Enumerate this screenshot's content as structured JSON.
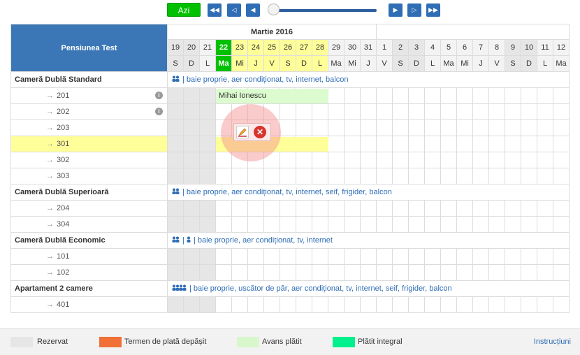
{
  "toolbar": {
    "today_label": "Azi"
  },
  "hotel": {
    "name": "Pensiunea Test"
  },
  "month": "Martie 2016",
  "days": [
    {
      "n": "19",
      "d": "S",
      "w": true
    },
    {
      "n": "20",
      "d": "D",
      "w": true
    },
    {
      "n": "21",
      "d": "L",
      "w": false
    },
    {
      "n": "22",
      "d": "Ma",
      "w": false,
      "today": true
    },
    {
      "n": "23",
      "d": "Mi",
      "y": true
    },
    {
      "n": "24",
      "d": "J",
      "y": true
    },
    {
      "n": "25",
      "d": "V",
      "y": true
    },
    {
      "n": "26",
      "d": "S",
      "y": true
    },
    {
      "n": "27",
      "d": "D",
      "y": true
    },
    {
      "n": "28",
      "d": "L",
      "y": true
    },
    {
      "n": "29",
      "d": "Ma"
    },
    {
      "n": "30",
      "d": "Mi"
    },
    {
      "n": "31",
      "d": "J"
    },
    {
      "n": "1",
      "d": "V"
    },
    {
      "n": "2",
      "d": "S",
      "w": true
    },
    {
      "n": "3",
      "d": "D",
      "w": true
    },
    {
      "n": "4",
      "d": "L"
    },
    {
      "n": "5",
      "d": "Ma"
    },
    {
      "n": "6",
      "d": "Mi"
    },
    {
      "n": "7",
      "d": "J"
    },
    {
      "n": "8",
      "d": "V"
    },
    {
      "n": "9",
      "d": "S",
      "w": true
    },
    {
      "n": "10",
      "d": "D",
      "w": true
    },
    {
      "n": "11",
      "d": "L"
    },
    {
      "n": "12",
      "d": "Ma"
    }
  ],
  "room_types": [
    {
      "name": "Cameră Dublă Standard",
      "desc": "| baie proprie, aer condiționat, tv, internet, balcon",
      "people_icons": 1,
      "rooms": [
        {
          "n": "201",
          "info": true
        },
        {
          "n": "202",
          "info": true
        },
        {
          "n": "203"
        },
        {
          "n": "301",
          "selected": true
        },
        {
          "n": "302"
        },
        {
          "n": "303"
        }
      ]
    },
    {
      "name": "Cameră Dublă Superioară",
      "desc": "| baie proprie, aer condiționat, tv, internet, seif, frigider, balcon",
      "people_icons": 1,
      "rooms": [
        {
          "n": "204"
        },
        {
          "n": "304"
        }
      ]
    },
    {
      "name": "Cameră Dublă Economic",
      "desc": "| baie proprie, aer condiționat, tv, internet",
      "people_icons": 2,
      "rooms": [
        {
          "n": "101"
        },
        {
          "n": "102"
        }
      ]
    },
    {
      "name": "Apartament 2 camere",
      "desc": "| baie proprie, uscător de păr, aer condiționat, tv, internet, seif, frigider, balcon",
      "people_icons": 1,
      "rooms": [
        {
          "n": "401"
        }
      ]
    }
  ],
  "booking": {
    "guest": "Mihai Ionescu"
  },
  "legend": {
    "reserved": "Rezervat",
    "overdue": "Termen de plată depășit",
    "advance": "Avans plătit",
    "paid": "Plătit integral",
    "instructions": "Instrucțiuni"
  },
  "colors": {
    "reserved": "#e6e6e6",
    "overdue": "#f07038",
    "advance": "#d8f8cc",
    "paid": "#00f08c",
    "accent": "#2f6db5"
  }
}
